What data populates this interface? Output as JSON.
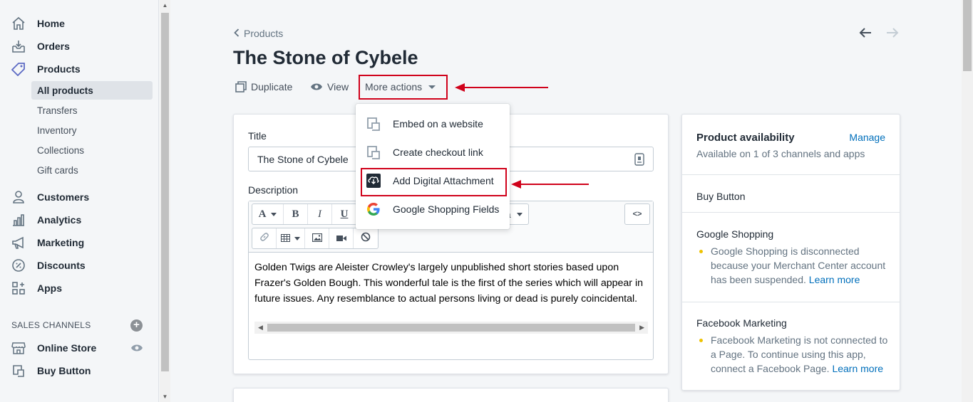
{
  "sidebar": {
    "items": [
      {
        "label": "Home",
        "icon": "home-icon"
      },
      {
        "label": "Orders",
        "icon": "orders-icon"
      },
      {
        "label": "Products",
        "icon": "tag-icon"
      },
      {
        "label": "Customers",
        "icon": "person-icon"
      },
      {
        "label": "Analytics",
        "icon": "bar-chart-icon"
      },
      {
        "label": "Marketing",
        "icon": "megaphone-icon"
      },
      {
        "label": "Discounts",
        "icon": "discount-icon"
      },
      {
        "label": "Apps",
        "icon": "apps-icon"
      }
    ],
    "product_sub_items": [
      "All products",
      "Transfers",
      "Inventory",
      "Collections",
      "Gift cards"
    ],
    "sales_channels_heading": "SALES CHANNELS",
    "channels": [
      {
        "label": "Online Store",
        "icon": "store-icon"
      },
      {
        "label": "Buy Button",
        "icon": "buy-button-icon"
      }
    ]
  },
  "header": {
    "breadcrumb": "Products",
    "title": "The Stone of Cybele",
    "actions": {
      "duplicate": "Duplicate",
      "view": "View",
      "more_actions": "More actions"
    }
  },
  "product_form": {
    "title_label": "Title",
    "title_value": "The Stone of Cybele",
    "description_label": "Description",
    "description_text": "Golden Twigs are Aleister Crowley's largely unpublished short stories based upon Frazer's Golden Bough. This wonderful tale is the first of the series which will appear in future issues. Any resemblance to actual persons living or dead is purely coincidental.",
    "toolbar": {
      "font_btn": "A",
      "bold_btn": "B",
      "italic_btn": "I",
      "underline_btn": "U",
      "code_btn": "<>",
      "hidden_btn": "a"
    }
  },
  "dropdown": {
    "items": [
      {
        "label": "Embed on a website",
        "icon": "embed-icon"
      },
      {
        "label": "Create checkout link",
        "icon": "checkout-link-icon"
      },
      {
        "label": "Add Digital Attachment",
        "icon": "digital-download-icon"
      },
      {
        "label": "Google Shopping Fields",
        "icon": "google-icon"
      }
    ]
  },
  "availability": {
    "title": "Product availability",
    "manage": "Manage",
    "subtitle": "Available on 1 of 3 channels and apps",
    "buy_button": "Buy Button",
    "google": {
      "heading": "Google Shopping",
      "message": "Google Shopping is disconnected because your Merchant Center account has been suspended.",
      "link": "Learn more"
    },
    "facebook": {
      "heading": "Facebook Marketing",
      "message": "Facebook Marketing is not connected to a Page. To continue using this app, connect a Facebook Page.",
      "link": "Learn more"
    }
  },
  "colors": {
    "annotation_red": "#d0021b",
    "link_blue": "#006fbb",
    "warning_yellow": "#eec200"
  }
}
